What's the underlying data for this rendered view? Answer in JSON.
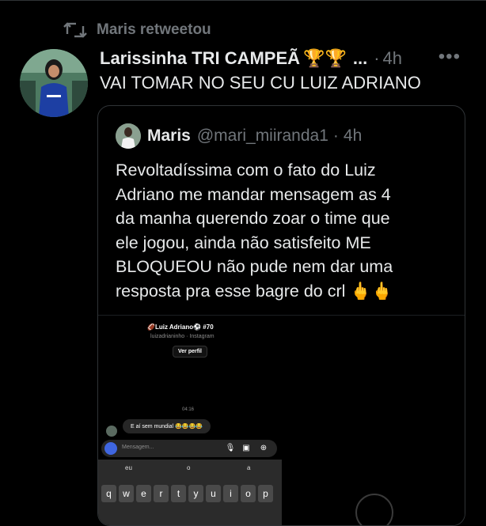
{
  "retweet": {
    "icon": "retweet-icon",
    "label": "Maris retweetou"
  },
  "tweet": {
    "author_name": "Larissinha TRI CAMPEÃ",
    "author_emoji": "🏆🏆",
    "ellipsis": "...",
    "separator": "·",
    "time": "4h",
    "more": "•••",
    "text": "VAI TOMAR NO SEU CU LUIZ ADRIANO"
  },
  "quote": {
    "name": "Maris",
    "handle": "@mari_miiranda1",
    "separator": "·",
    "time": "4h",
    "lines": [
      "Revoltadíssima com o fato do Luiz",
      "Adriano me mandar mensagem as 4",
      "da manha querendo zoar o time que",
      "ele jogou, ainda não satisfeito ME",
      "BLOQUEOU não pude nem dar uma",
      "resposta pra esse bagre do crl 🖕🖕"
    ],
    "screenshot": {
      "profile_name": "🏈Luiz Adriano⚽ #70",
      "profile_sub": "luizadrianinho · Instagram",
      "profile_button": "Ver perfil",
      "msg_time": "04:16",
      "message": "E aí sem mundial 😂😂😂😂",
      "input_placeholder": "Mensagem...",
      "suggestions": [
        "eu",
        "o",
        "a"
      ],
      "keys": [
        "q",
        "w",
        "e",
        "r",
        "t",
        "y",
        "u",
        "i",
        "o",
        "p"
      ]
    }
  }
}
